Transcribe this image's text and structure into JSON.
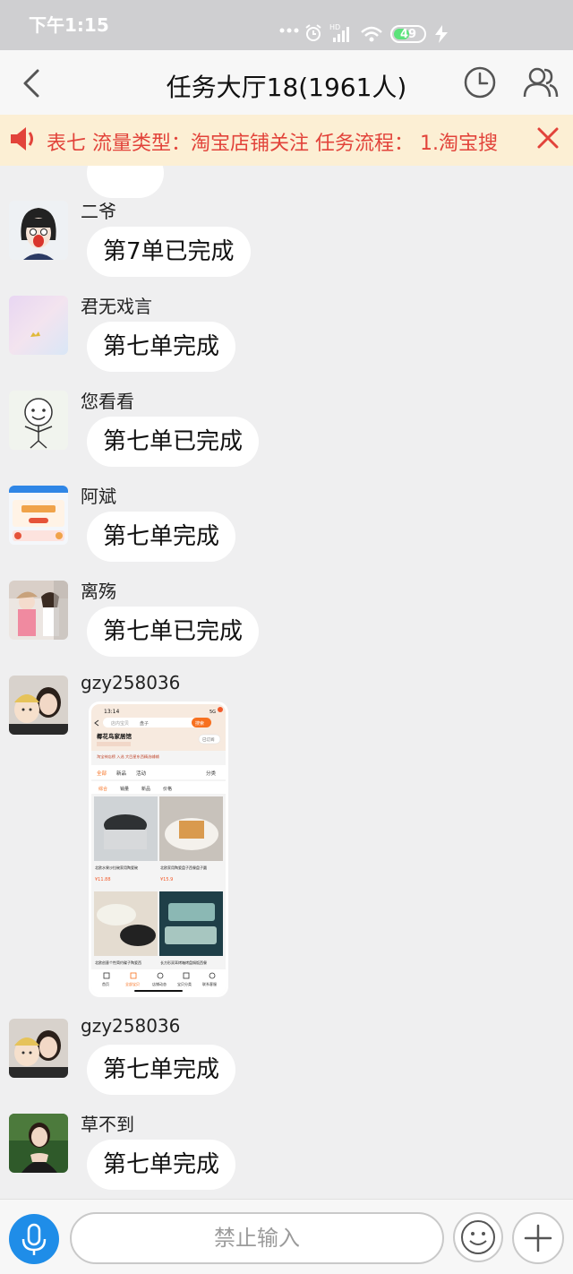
{
  "status_bar": {
    "time": "下午1:15",
    "battery": "49"
  },
  "header": {
    "title": "任务大厅18(1961人)"
  },
  "notice": {
    "text": "表七 流量类型：淘宝店铺关注 任务流程： 1.淘宝搜"
  },
  "messages": [
    {
      "nick": "二爷",
      "text": "第7单已完成"
    },
    {
      "nick": "君无戏言",
      "text": "第七单完成"
    },
    {
      "nick": "您看看",
      "text": "第七单已完成"
    },
    {
      "nick": "阿斌",
      "text": "第七单完成"
    },
    {
      "nick": "离殇",
      "text": "第七单已完成"
    },
    {
      "nick": "gzy258036",
      "shop_screenshot": {
        "time": "13:14",
        "signal": "5G",
        "search_placeholder": "店内宝贝",
        "search_term": "盘子",
        "search_btn": "搜索",
        "shop_name": "椰花鸟家居馆",
        "follow": "已订阅",
        "member_line": "淘宝神店榜 入选 大目星东西精选辅辅",
        "tabs": [
          "全部",
          "新品",
          "活动"
        ],
        "category": "分类",
        "sorts": [
          "综合",
          "销量",
          "新品",
          "价格"
        ],
        "products": [
          {
            "name": "北欧水果沙拉碗家用陶瓷碗",
            "price": "¥11.88"
          },
          {
            "name": "北欧家用陶瓷盘子西餐盘子圆",
            "price": "¥15.9"
          },
          {
            "name": "北欧创意个性简约碟子陶瓷西",
            "price": ""
          },
          {
            "name": "长方形双耳烤箱烤盘焗饭西餐",
            "price": ""
          }
        ],
        "nav": [
          "首页",
          "全部宝贝",
          "店铺动态",
          "宝贝分类",
          "联系客服"
        ]
      }
    },
    {
      "nick": "gzy258036",
      "text": "第七单完成"
    },
    {
      "nick": "草不到",
      "text": "第七单完成"
    }
  ],
  "input": {
    "placeholder": "禁止输入"
  },
  "colors": {
    "accent": "#1f8de8",
    "notice_text": "#e2433a",
    "notice_bg": "#fcefd4"
  }
}
